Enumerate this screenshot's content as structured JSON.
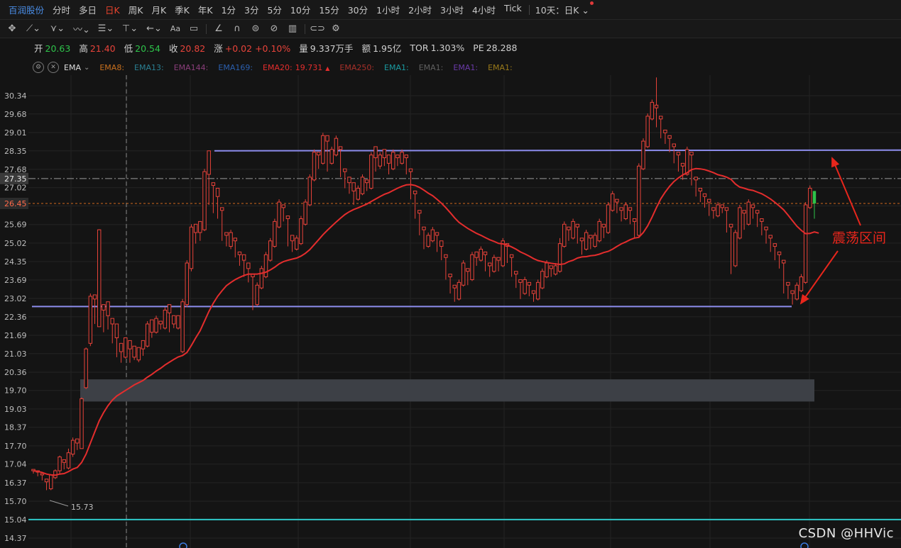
{
  "period_bar": {
    "stock_name": "百润股份",
    "periods": [
      "分时",
      "多日",
      "日K",
      "周K",
      "月K",
      "季K",
      "年K",
      "1分",
      "3分",
      "5分",
      "10分",
      "15分",
      "30分",
      "1小时",
      "2小时",
      "3小时",
      "4小时",
      "Tick"
    ],
    "active_period": "日K",
    "dropdown_label": "10天：日K"
  },
  "toolbar": {
    "tools": [
      "crosshair-icon",
      "trendline-icon",
      "pitchfork-icon",
      "wave-icon",
      "fib-icon",
      "anchor-icon",
      "arrow-icon",
      "text-icon",
      "note-icon",
      "pencil-icon",
      "magnet-icon",
      "eraser-icon",
      "hide-icon",
      "trash-icon",
      "link-icon",
      "settings-icon"
    ]
  },
  "quote": {
    "open_label": "开",
    "open": "20.63",
    "high_label": "高",
    "high": "21.40",
    "low_label": "低",
    "low": "20.54",
    "close_label": "收",
    "close": "20.82",
    "change_label": "涨",
    "change": "+0.02",
    "change_pct": "+0.10%",
    "volume_label": "量",
    "volume": "9.337万手",
    "amount_label": "额",
    "amount": "1.95亿",
    "tor_label": "TOR",
    "tor": "1.303%",
    "pe_label": "PE",
    "pe": "28.288"
  },
  "ema_bar": {
    "indicator": "EMA",
    "lines": [
      {
        "label": "EMA8:",
        "color": "#c8701e"
      },
      {
        "label": "EMA13:",
        "color": "#2a7f92"
      },
      {
        "label": "EMA144:",
        "color": "#8a3e7a"
      },
      {
        "label": "EMA169:",
        "color": "#2b5fae"
      },
      {
        "label": "EMA20:",
        "value": "19.731",
        "color": "#e42d2d"
      },
      {
        "label": "EMA250:",
        "color": "#a8302a"
      },
      {
        "label": "EMA1:",
        "color": "#1a9aa0"
      },
      {
        "label": "EMA1:",
        "color": "#606060"
      },
      {
        "label": "EMA1:",
        "color": "#6a3aa8"
      },
      {
        "label": "EMA1:",
        "color": "#9a7a1a"
      }
    ],
    "ema20_arrow": "▲"
  },
  "chart_data": {
    "type": "candlestick",
    "y_ticks": [
      "30.34",
      "29.68",
      "29.01",
      "28.35",
      "27.68",
      "27.02",
      "26.36",
      "25.69",
      "25.02",
      "24.35",
      "23.69",
      "23.02",
      "22.36",
      "21.69",
      "21.03",
      "20.36",
      "19.70",
      "19.03",
      "18.37",
      "17.70",
      "17.04",
      "16.37",
      "15.70",
      "15.04",
      "14.37"
    ],
    "ylim": [
      14.37,
      30.34
    ],
    "highlight_price_left": "27.35",
    "current_price_label": "26.45",
    "low_marker": "15.73",
    "resistance_price": 28.35,
    "support_price": 22.73,
    "cyan_line_price": 15.04,
    "gap_zone": [
      19.3,
      20.1
    ],
    "annotation": "震荡区间",
    "candles": [
      [
        16.8,
        16.85,
        16.7,
        16.68
      ],
      [
        16.75,
        16.8,
        16.6,
        16.58
      ],
      [
        16.65,
        16.7,
        16.45,
        16.4
      ],
      [
        16.4,
        16.5,
        16.1,
        15.73
      ],
      [
        16.15,
        16.65,
        16.1,
        16.68
      ],
      [
        16.55,
        16.8,
        16.5,
        16.85
      ],
      [
        16.8,
        17.3,
        16.7,
        17.35
      ],
      [
        17.1,
        17.2,
        16.85,
        16.8
      ],
      [
        16.9,
        17.45,
        16.85,
        17.6
      ],
      [
        17.4,
        17.9,
        17.3,
        18.0
      ],
      [
        17.8,
        17.95,
        17.55,
        17.5
      ],
      [
        17.6,
        19.4,
        17.6,
        19.45
      ],
      [
        19.8,
        21.2,
        19.75,
        21.25
      ],
      [
        21.4,
        23.1,
        21.3,
        23.2
      ],
      [
        23.0,
        23.15,
        22.1,
        21.7
      ],
      [
        22.0,
        25.5,
        22.0,
        25.52
      ],
      [
        22.6,
        22.8,
        21.8,
        21.6
      ],
      [
        22.4,
        22.9,
        21.9,
        21.5
      ],
      [
        22.1,
        22.3,
        21.4,
        21.2
      ],
      [
        21.6,
        22.1,
        20.9,
        20.7
      ],
      [
        21.1,
        21.4,
        20.7,
        20.6
      ],
      [
        20.9,
        21.6,
        20.85,
        20.55
      ],
      [
        21.2,
        21.5,
        20.7,
        20.5
      ],
      [
        20.9,
        21.3,
        20.8,
        20.7
      ],
      [
        20.8,
        21.25,
        20.72,
        20.55
      ],
      [
        21.2,
        21.5,
        20.95,
        20.9
      ],
      [
        21.3,
        22.1,
        21.25,
        22.2
      ],
      [
        21.8,
        22.25,
        21.6,
        21.5
      ],
      [
        21.8,
        22.3,
        21.75,
        22.4
      ],
      [
        22.1,
        22.2,
        21.9,
        21.75
      ],
      [
        21.95,
        22.6,
        21.9,
        22.7
      ],
      [
        22.5,
        22.8,
        21.8,
        21.7
      ],
      [
        22.1,
        22.4,
        21.95,
        21.85
      ],
      [
        21.95,
        22.4,
        21.9,
        21.8
      ],
      [
        21.1,
        22.9,
        21.05,
        23.0
      ],
      [
        22.8,
        24.3,
        22.7,
        24.4
      ],
      [
        24.1,
        25.6,
        24.0,
        25.7
      ],
      [
        25.4,
        25.7,
        25.0,
        24.8
      ],
      [
        25.4,
        25.8,
        25.1,
        24.9
      ],
      [
        25.5,
        27.6,
        25.45,
        27.7
      ],
      [
        27.5,
        28.35,
        26.4,
        26.3
      ],
      [
        27.1,
        27.2,
        26.1,
        26.0
      ],
      [
        26.7,
        27.0,
        25.9,
        25.8
      ],
      [
        26.2,
        26.3,
        25.1,
        25.0
      ],
      [
        25.3,
        25.4,
        24.9,
        24.7
      ],
      [
        24.9,
        25.4,
        24.8,
        25.5
      ],
      [
        25.1,
        25.2,
        24.5,
        24.4
      ],
      [
        24.6,
        24.7,
        24.2,
        24.1
      ],
      [
        24.4,
        24.6,
        23.8,
        23.7
      ],
      [
        24.1,
        24.3,
        23.6,
        23.5
      ],
      [
        23.8,
        23.9,
        22.6,
        22.5
      ],
      [
        22.8,
        23.5,
        22.75,
        23.6
      ],
      [
        23.4,
        24.1,
        23.35,
        24.2
      ],
      [
        23.8,
        24.6,
        23.75,
        24.7
      ],
      [
        24.4,
        25.1,
        24.35,
        25.2
      ],
      [
        24.9,
        25.8,
        24.85,
        25.9
      ],
      [
        25.6,
        26.5,
        25.55,
        26.6
      ],
      [
        26.3,
        26.4,
        25.8,
        25.7
      ],
      [
        25.9,
        26.0,
        24.9,
        24.8
      ],
      [
        25.1,
        25.3,
        24.7,
        24.6
      ],
      [
        24.8,
        25.2,
        24.75,
        25.3
      ],
      [
        25.0,
        25.9,
        24.95,
        26.0
      ],
      [
        25.7,
        26.5,
        25.65,
        26.6
      ],
      [
        26.4,
        27.4,
        26.35,
        27.5
      ],
      [
        27.3,
        28.3,
        27.25,
        28.4
      ],
      [
        28.2,
        28.3,
        27.7,
        27.6
      ],
      [
        27.9,
        28.9,
        27.85,
        29.0
      ],
      [
        28.7,
        28.9,
        27.6,
        27.5
      ],
      [
        27.9,
        28.4,
        27.85,
        28.5
      ],
      [
        28.2,
        28.8,
        28.15,
        28.9
      ],
      [
        28.4,
        28.5,
        27.4,
        27.3
      ],
      [
        27.6,
        27.7,
        27.0,
        26.9
      ],
      [
        27.2,
        27.4,
        26.8,
        26.7
      ],
      [
        26.9,
        27.2,
        26.4,
        26.3
      ],
      [
        26.6,
        27.0,
        26.55,
        27.1
      ],
      [
        26.8,
        27.4,
        26.75,
        27.5
      ],
      [
        27.2,
        27.3,
        26.9,
        26.8
      ],
      [
        27.0,
        28.2,
        26.95,
        28.3
      ],
      [
        28.1,
        28.5,
        27.6,
        27.5
      ],
      [
        27.8,
        28.2,
        27.7,
        28.3
      ],
      [
        28.1,
        28.4,
        27.8,
        27.7
      ],
      [
        27.9,
        28.2,
        27.5,
        27.4
      ],
      [
        27.7,
        28.3,
        27.65,
        28.4
      ],
      [
        28.1,
        28.2,
        27.8,
        27.7
      ],
      [
        27.9,
        28.3,
        27.85,
        28.4
      ],
      [
        28.1,
        28.2,
        27.5,
        27.4
      ],
      [
        27.6,
        27.7,
        26.6,
        26.5
      ],
      [
        26.8,
        26.9,
        25.9,
        25.8
      ],
      [
        26.1,
        26.2,
        25.3,
        25.2
      ],
      [
        25.5,
        25.6,
        24.8,
        24.7
      ],
      [
        24.9,
        25.3,
        24.85,
        25.4
      ],
      [
        25.1,
        25.5,
        25.05,
        25.6
      ],
      [
        25.3,
        25.4,
        24.7,
        24.6
      ],
      [
        24.9,
        25.1,
        24.4,
        24.3
      ],
      [
        24.5,
        24.6,
        23.7,
        23.6
      ],
      [
        23.8,
        23.9,
        23.2,
        23.1
      ],
      [
        23.4,
        23.5,
        22.9,
        22.8
      ],
      [
        23.0,
        23.6,
        22.95,
        23.7
      ],
      [
        23.5,
        24.3,
        23.45,
        24.4
      ],
      [
        24.0,
        24.1,
        23.5,
        23.4
      ],
      [
        23.7,
        24.6,
        23.65,
        24.7
      ],
      [
        24.5,
        24.7,
        24.2,
        24.1
      ],
      [
        24.4,
        24.8,
        24.35,
        24.9
      ],
      [
        24.6,
        24.7,
        24.0,
        23.9
      ],
      [
        24.2,
        24.3,
        23.8,
        23.7
      ],
      [
        24.0,
        24.5,
        23.95,
        24.6
      ],
      [
        24.4,
        24.5,
        24.0,
        23.9
      ],
      [
        24.2,
        25.1,
        24.15,
        25.2
      ],
      [
        24.9,
        25.0,
        24.3,
        24.2
      ],
      [
        24.5,
        24.6,
        23.8,
        23.7
      ],
      [
        23.9,
        24.0,
        23.4,
        23.3
      ],
      [
        23.6,
        23.7,
        23.0,
        22.9
      ],
      [
        23.2,
        23.7,
        23.15,
        23.8
      ],
      [
        23.5,
        23.6,
        23.1,
        23.0
      ],
      [
        23.2,
        23.3,
        22.9,
        22.8
      ],
      [
        23.0,
        23.6,
        22.95,
        23.7
      ],
      [
        23.4,
        24.0,
        23.35,
        24.1
      ],
      [
        23.8,
        24.3,
        23.75,
        24.4
      ],
      [
        24.1,
        24.2,
        23.8,
        23.7
      ],
      [
        23.9,
        24.2,
        23.85,
        24.3
      ],
      [
        24.0,
        25.0,
        23.95,
        25.2
      ],
      [
        24.9,
        25.7,
        24.85,
        25.8
      ],
      [
        25.5,
        25.6,
        25.1,
        25.0
      ],
      [
        25.2,
        25.8,
        25.15,
        25.9
      ],
      [
        25.6,
        25.7,
        25.0,
        24.9
      ],
      [
        25.1,
        25.2,
        24.6,
        24.5
      ],
      [
        24.8,
        25.4,
        24.75,
        25.5
      ],
      [
        25.2,
        25.3,
        24.8,
        24.7
      ],
      [
        24.9,
        25.3,
        24.85,
        25.4
      ],
      [
        25.1,
        25.8,
        25.05,
        25.9
      ],
      [
        25.6,
        25.7,
        25.2,
        25.1
      ],
      [
        25.4,
        26.4,
        25.35,
        26.5
      ],
      [
        26.2,
        26.8,
        26.15,
        26.9
      ],
      [
        26.5,
        26.6,
        26.1,
        26.0
      ],
      [
        26.2,
        26.3,
        25.8,
        25.7
      ],
      [
        25.9,
        26.4,
        25.85,
        26.5
      ],
      [
        26.2,
        26.3,
        25.7,
        25.6
      ],
      [
        25.8,
        25.9,
        25.2,
        25.1
      ],
      [
        25.3,
        27.8,
        25.25,
        27.9
      ],
      [
        27.7,
        28.7,
        27.65,
        28.8
      ],
      [
        28.5,
        29.6,
        28.45,
        29.7
      ],
      [
        29.5,
        30.1,
        29.45,
        30.2
      ],
      [
        29.9,
        30.0,
        29.2,
        31.0
      ],
      [
        29.5,
        29.6,
        28.8,
        28.7
      ],
      [
        29.0,
        29.1,
        28.6,
        28.5
      ],
      [
        28.8,
        28.9,
        28.3,
        28.2
      ],
      [
        28.5,
        28.6,
        27.9,
        27.8
      ],
      [
        28.2,
        28.3,
        27.6,
        27.5
      ],
      [
        27.8,
        27.9,
        27.3,
        27.2
      ],
      [
        27.5,
        28.4,
        27.45,
        28.5
      ],
      [
        28.2,
        28.3,
        27.1,
        27.0
      ],
      [
        27.3,
        27.4,
        26.7,
        26.6
      ],
      [
        26.9,
        27.0,
        26.5,
        26.4
      ],
      [
        26.7,
        26.8,
        26.3,
        26.2
      ],
      [
        26.5,
        26.6,
        26.0,
        25.9
      ],
      [
        26.2,
        26.3,
        25.9,
        25.8
      ],
      [
        26.0,
        26.4,
        25.95,
        26.5
      ],
      [
        26.3,
        26.4,
        26.1,
        26.0
      ],
      [
        26.2,
        26.3,
        25.4,
        25.3
      ],
      [
        25.6,
        25.7,
        23.9,
        23.6
      ],
      [
        24.2,
        25.4,
        24.15,
        25.5
      ],
      [
        25.2,
        26.3,
        25.15,
        26.4
      ],
      [
        26.1,
        26.2,
        25.5,
        25.4
      ],
      [
        25.7,
        26.5,
        25.65,
        26.6
      ],
      [
        26.3,
        26.4,
        25.9,
        25.8
      ],
      [
        26.1,
        26.2,
        25.6,
        25.5
      ],
      [
        25.8,
        25.9,
        25.3,
        25.2
      ],
      [
        25.5,
        25.6,
        25.0,
        24.9
      ],
      [
        25.2,
        25.3,
        24.7,
        24.6
      ],
      [
        24.9,
        25.0,
        24.4,
        24.3
      ],
      [
        24.6,
        24.7,
        24.1,
        24.0
      ],
      [
        24.3,
        24.4,
        23.2,
        23.1
      ],
      [
        23.5,
        23.6,
        23.0,
        22.9
      ],
      [
        23.2,
        23.3,
        22.8,
        22.73
      ],
      [
        23.0,
        23.5,
        22.95,
        23.6
      ],
      [
        23.3,
        23.8,
        23.25,
        23.9
      ],
      [
        23.6,
        26.4,
        23.55,
        26.5
      ],
      [
        26.3,
        27.0,
        26.25,
        27.1
      ],
      [
        26.9,
        26.45,
        25.9,
        25.8
      ]
    ],
    "ema20": [
      16.8,
      16.78,
      16.74,
      16.68,
      16.65,
      16.64,
      16.68,
      16.7,
      16.77,
      16.86,
      16.92,
      17.1,
      17.4,
      17.8,
      18.2,
      18.6,
      18.9,
      19.15,
      19.35,
      19.5,
      19.6,
      19.7,
      19.8,
      19.9,
      19.98,
      20.06,
      20.18,
      20.28,
      20.4,
      20.5,
      20.62,
      20.72,
      20.82,
      20.91,
      20.96,
      21.07,
      21.32,
      21.6,
      21.85,
      22.2,
      22.55,
      22.85,
      23.1,
      23.3,
      23.48,
      23.6,
      23.7,
      23.78,
      23.85,
      23.9,
      23.9,
      23.9,
      23.93,
      23.97,
      24.05,
      24.15,
      24.27,
      24.35,
      24.4,
      24.44,
      24.48,
      24.55,
      24.65,
      24.78,
      24.96,
      25.14,
      25.32,
      25.48,
      25.63,
      25.78,
      25.92,
      26.05,
      26.15,
      26.23,
      26.29,
      26.36,
      26.43,
      26.52,
      26.61,
      26.7,
      26.78,
      26.84,
      26.92,
      27.0,
      27.07,
      27.12,
      27.13,
      27.1,
      27.03,
      26.93,
      26.82,
      26.73,
      26.6,
      26.46,
      26.3,
      26.12,
      25.93,
      25.77,
      25.66,
      25.55,
      25.46,
      25.37,
      25.3,
      25.22,
      25.14,
      25.08,
      25.01,
      24.99,
      24.95,
      24.88,
      24.8,
      24.7,
      24.63,
      24.55,
      24.46,
      24.39,
      24.35,
      24.32,
      24.29,
      24.27,
      24.25,
      24.27,
      24.35,
      24.4,
      24.48,
      24.52,
      24.53,
      24.56,
      24.58,
      24.62,
      24.68,
      24.72,
      24.8,
      24.9,
      24.99,
      25.06,
      25.14,
      25.2,
      25.23,
      25.4,
      25.64,
      25.95,
      26.3,
      26.62,
      26.86,
      27.07,
      27.24,
      27.37,
      27.48,
      27.56,
      27.67,
      27.71,
      27.7,
      27.67,
      27.62,
      27.56,
      27.49,
      27.45,
      27.4,
      27.32,
      27.15,
      27.04,
      27.0,
      26.95,
      26.92,
      26.86,
      26.8,
      26.71,
      26.61,
      26.49,
      26.36,
      26.22,
      26.03,
      25.83,
      25.63,
      25.48,
      25.36,
      25.37,
      25.42,
      25.38
    ]
  },
  "watermark": "CSDN @HHVic"
}
